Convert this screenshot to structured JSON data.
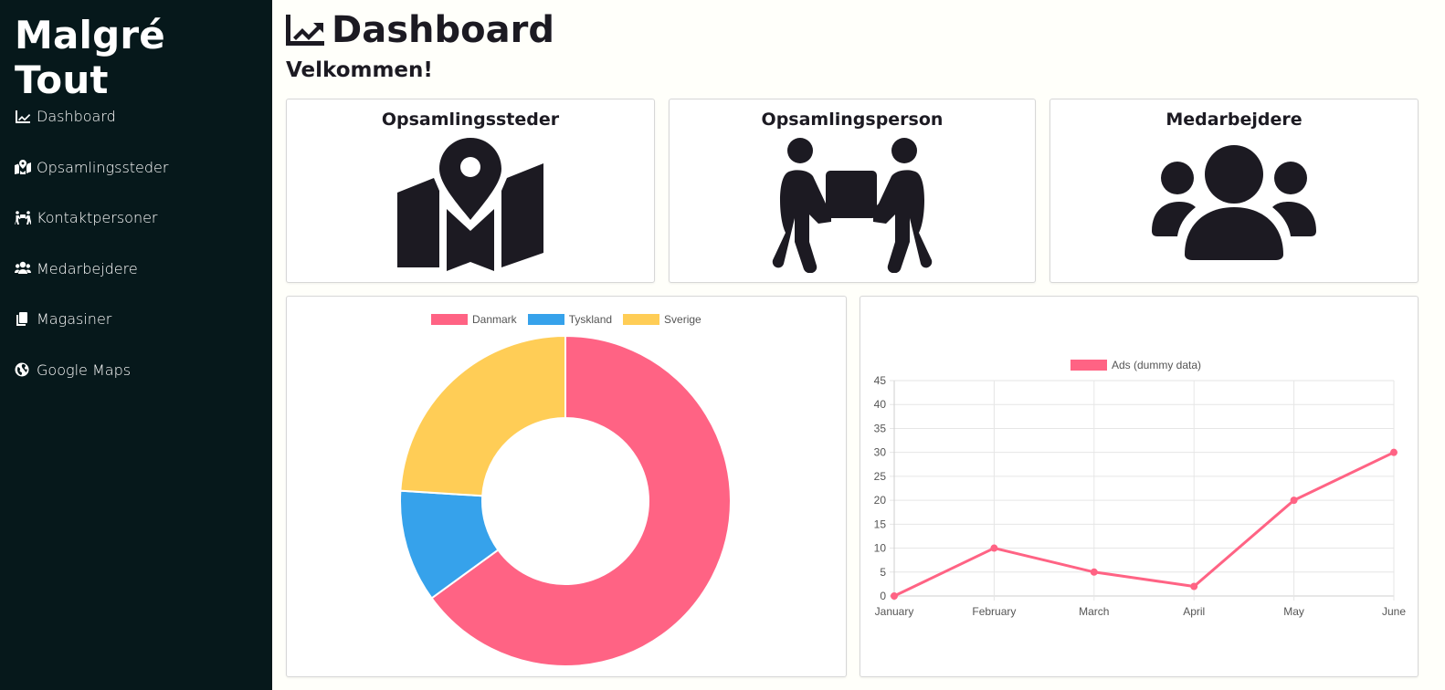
{
  "sidebar": {
    "brand": "Malgré Tout",
    "items": [
      {
        "label": "Dashboard",
        "icon": "chart-line-icon"
      },
      {
        "label": "Opsamlingssteder",
        "icon": "map-location-icon"
      },
      {
        "label": "Kontaktpersoner",
        "icon": "people-carry-icon"
      },
      {
        "label": "Medarbejdere",
        "icon": "users-icon"
      },
      {
        "label": "Magasiner",
        "icon": "copy-icon"
      },
      {
        "label": "Google Maps",
        "icon": "globe-icon"
      }
    ]
  },
  "header": {
    "title": "Dashboard",
    "welcome": "Velkommen!"
  },
  "cards": [
    {
      "title": "Opsamlingssteder",
      "icon": "map-location-icon"
    },
    {
      "title": "Opsamlingsperson",
      "icon": "people-carry-icon"
    },
    {
      "title": "Medarbejdere",
      "icon": "users-icon"
    }
  ],
  "colors": {
    "sidebar_bg": "#06181b",
    "page_bg": "#fffffa",
    "pink": "#ff6384",
    "blue": "#36a2eb",
    "yellow": "#ffcd56"
  },
  "chart_data": [
    {
      "type": "pie",
      "variant": "doughnut",
      "labels": [
        "Danmark",
        "Tyskland",
        "Sverige"
      ],
      "values": [
        65,
        11,
        24
      ],
      "colors": [
        "#ff6384",
        "#36a2eb",
        "#ffcd56"
      ],
      "legend": "top"
    },
    {
      "type": "line",
      "categories": [
        "January",
        "February",
        "March",
        "April",
        "May",
        "June"
      ],
      "series": [
        {
          "name": "Ads (dummy data)",
          "values": [
            0,
            10,
            5,
            2,
            20,
            30
          ],
          "color": "#ff6384"
        }
      ],
      "ylim": [
        0,
        45
      ],
      "yticks": [
        0,
        5,
        10,
        15,
        20,
        25,
        30,
        35,
        40,
        45
      ],
      "grid": true,
      "legend": "top"
    }
  ]
}
